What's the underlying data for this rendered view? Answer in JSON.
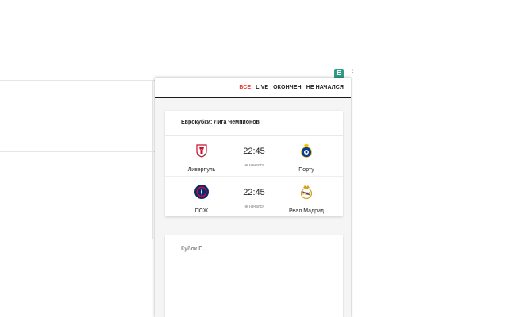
{
  "browser": {
    "extension_icon_letter": "E",
    "menu_glyph": "⋮"
  },
  "filters": [
    {
      "label": "ВСЕ",
      "active": true
    },
    {
      "label": "LIVE",
      "active": false
    },
    {
      "label": "ОКОНЧЕН",
      "active": false
    },
    {
      "label": "НЕ НАЧАЛСЯ",
      "active": false
    }
  ],
  "tournament": {
    "title": "Еврокубки: Лига Чемпионов",
    "matches": [
      {
        "home": {
          "name": "Ливерпуль",
          "crest": "liverpool-crest-icon"
        },
        "away": {
          "name": "Порту",
          "crest": "porto-crest-icon"
        },
        "time": "22:45",
        "status": "не начался"
      },
      {
        "home": {
          "name": "ПСЖ",
          "crest": "psg-crest-icon"
        },
        "away": {
          "name": "Реал Мадрид",
          "crest": "real-madrid-crest-icon"
        },
        "time": "22:45",
        "status": "не начался"
      }
    ]
  },
  "next_tournament": {
    "title": "Кубок Г..."
  },
  "colors": {
    "active_filter": "#e53935",
    "divider": "#1a1a1a",
    "extension_icon": "#2e9c86"
  }
}
